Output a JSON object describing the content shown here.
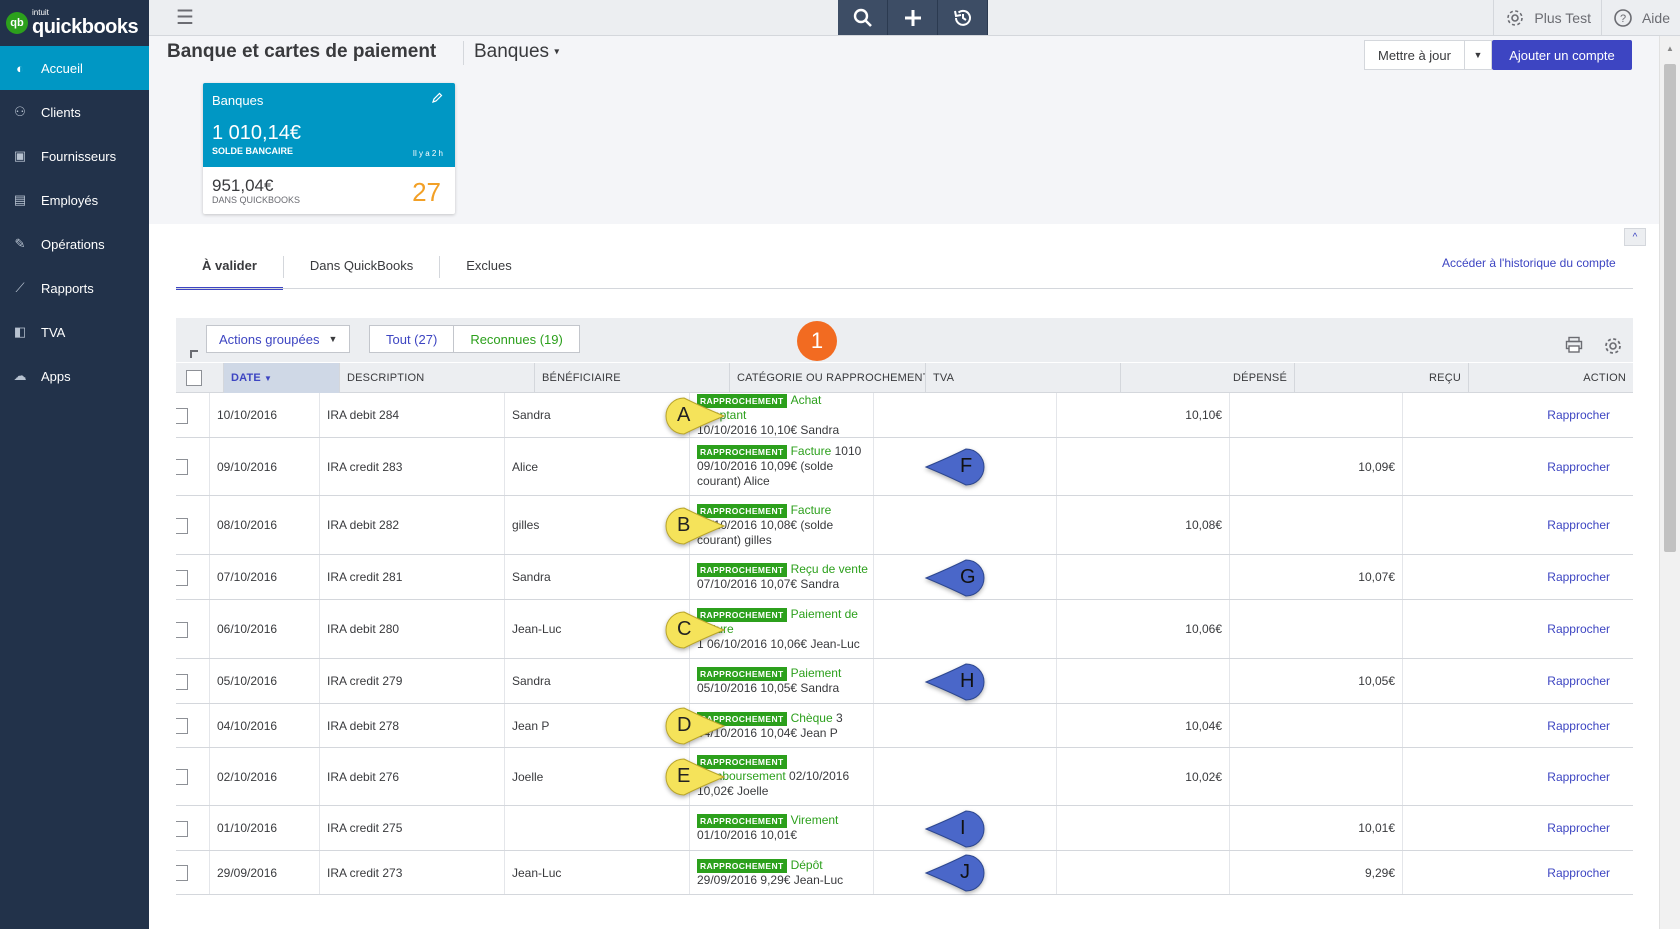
{
  "logo": {
    "intuit": "intuit",
    "brand": "quickbooks",
    "mark": "qb"
  },
  "sidebar": {
    "items": [
      {
        "label": "Accueil",
        "icon": "dashboard-icon"
      },
      {
        "label": "Clients",
        "icon": "customers-icon"
      },
      {
        "label": "Fournisseurs",
        "icon": "vendors-icon"
      },
      {
        "label": "Employés",
        "icon": "employees-icon"
      },
      {
        "label": "Opérations",
        "icon": "transactions-icon"
      },
      {
        "label": "Rapports",
        "icon": "reports-icon"
      },
      {
        "label": "TVA",
        "icon": "tax-icon"
      },
      {
        "label": "Apps",
        "icon": "apps-icon"
      }
    ]
  },
  "topbar": {
    "settings_label": "Plus Test",
    "help_label": "Aide"
  },
  "header": {
    "title": "Banque et cartes de paiement",
    "account": "Banques",
    "update_label": "Mettre à jour",
    "add_account_label": "Ajouter un compte"
  },
  "bank_card": {
    "name": "Banques",
    "bank_balance": "1 010,14€",
    "bank_balance_label": "SOLDE BANCAIRE",
    "updated": "Il y a 2 h",
    "qb_balance": "951,04€",
    "qb_balance_label": "DANS QUICKBOOKS",
    "to_review_count": "27"
  },
  "tabs": [
    {
      "label": "À valider"
    },
    {
      "label": "Dans QuickBooks"
    },
    {
      "label": "Exclues"
    }
  ],
  "history_link": "Accéder à l'historique du compte",
  "toolbar": {
    "bulk_label": "Actions groupées",
    "filter_all": "Tout (27)",
    "filter_recognized": "Reconnues (19)",
    "marker": "1"
  },
  "table": {
    "headers": {
      "date": "DATE",
      "description": "DESCRIPTION",
      "payee": "BÉNÉFICIAIRE",
      "category": "CATÉGORIE OU RAPPROCHEMENT",
      "tax": "TVA",
      "spent": "DÉPENSÉ",
      "received": "REÇU",
      "action": "ACTION"
    },
    "badge": "RAPPROCHEMENT",
    "rows": [
      {
        "date": "10/10/2016",
        "description": "IRA debit 284",
        "payee": "Sandra",
        "type": "Achat comptant",
        "type_suffix": "",
        "detail": "10/10/2016 10,10€ Sandra",
        "spent": "10,10€",
        "received": "",
        "action": "Rapprocher",
        "marker": "A",
        "marker_side": "left"
      },
      {
        "date": "09/10/2016",
        "description": "IRA credit 283",
        "payee": "Alice",
        "type": "Facture",
        "type_suffix": " 1010",
        "detail": "09/10/2016 10,09€ (solde courant) Alice",
        "spent": "",
        "received": "10,09€",
        "action": "Rapprocher",
        "marker": "F",
        "marker_side": "right"
      },
      {
        "date": "08/10/2016",
        "description": "IRA debit 282",
        "payee": "gilles",
        "type": "Facture",
        "type_suffix": "",
        "detail": "08/10/2016 10,08€ (solde courant) gilles",
        "spent": "10,08€",
        "received": "",
        "action": "Rapprocher",
        "marker": "B",
        "marker_side": "left"
      },
      {
        "date": "07/10/2016",
        "description": "IRA credit 281",
        "payee": "Sandra",
        "type": "Reçu de vente",
        "type_suffix": "",
        "detail": "07/10/2016 10,07€ Sandra",
        "spent": "",
        "received": "10,07€",
        "action": "Rapprocher",
        "marker": "G",
        "marker_side": "right"
      },
      {
        "date": "06/10/2016",
        "description": "IRA debit 280",
        "payee": "Jean-Luc",
        "type": "Paiement de facture",
        "type_suffix": "",
        "detail": "1 06/10/2016 10,06€ Jean-Luc",
        "spent": "10,06€",
        "received": "",
        "action": "Rapprocher",
        "marker": "C",
        "marker_side": "left"
      },
      {
        "date": "05/10/2016",
        "description": "IRA credit 279",
        "payee": "Sandra",
        "type": "Paiement",
        "type_suffix": "",
        "detail": "05/10/2016 10,05€ Sandra",
        "spent": "",
        "received": "10,05€",
        "action": "Rapprocher",
        "marker": "H",
        "marker_side": "right"
      },
      {
        "date": "04/10/2016",
        "description": "IRA debit 278",
        "payee": "Jean P",
        "type": "Chèque",
        "type_suffix": " 3",
        "detail": "04/10/2016 10,04€ Jean P",
        "spent": "10,04€",
        "received": "",
        "action": "Rapprocher",
        "marker": "D",
        "marker_side": "left"
      },
      {
        "date": "02/10/2016",
        "description": "IRA debit 276",
        "payee": "Joelle",
        "type": "Remboursement",
        "type_suffix": " 02/10/2016",
        "detail": "10,02€ Joelle",
        "spent": "10,02€",
        "received": "",
        "action": "Rapprocher",
        "marker": "E",
        "marker_side": "left"
      },
      {
        "date": "01/10/2016",
        "description": "IRA credit 275",
        "payee": "",
        "type": "Virement",
        "type_suffix": "",
        "detail": "01/10/2016 10,01€",
        "spent": "",
        "received": "10,01€",
        "action": "Rapprocher",
        "marker": "I",
        "marker_side": "right"
      },
      {
        "date": "29/09/2016",
        "description": "IRA credit 273",
        "payee": "Jean-Luc",
        "type": "Dépôt",
        "type_suffix": "",
        "detail": "29/09/2016 9,29€ Jean-Luc",
        "spent": "",
        "received": "9,29€",
        "action": "Rapprocher",
        "marker": "J",
        "marker_side": "right"
      }
    ]
  },
  "colors": {
    "accent": "#0097c4",
    "primary": "#3d45c2",
    "match_green": "#2ca01c",
    "marker_left": "#f5e35a",
    "marker_right": "#4a67c9",
    "marker_1": "#f26b21"
  }
}
